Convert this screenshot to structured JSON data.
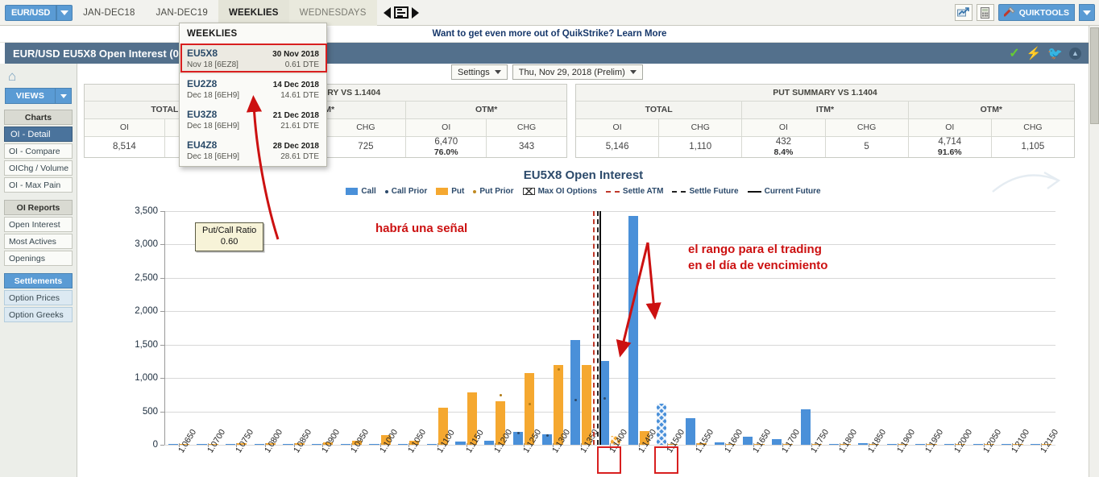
{
  "tabbar": {
    "symbol": "EUR/USD",
    "symbol_arrow": "chevron-down-icon",
    "tabs": [
      {
        "label": "JAN-DEC18",
        "state": "normal"
      },
      {
        "label": "JAN-DEC19",
        "state": "normal"
      },
      {
        "label": "WEEKLIES",
        "state": "active"
      },
      {
        "label": "WEDNESDAYS",
        "state": "dim"
      }
    ],
    "quiktools_label": "QUIKTOOLS",
    "icons": [
      "prev-arrow-icon",
      "list-view-icon",
      "next-arrow-icon",
      "chart-up-icon",
      "calculator-icon",
      "wrench-icon",
      "chevron-down-icon"
    ]
  },
  "promo": {
    "text": "Want to get even more out of QuikStrike? Learn More"
  },
  "titlebar": {
    "title": "EUR/USD EU5X8 Open Interest (0.8 ",
    "icons": [
      "check-icon",
      "bolt-icon",
      "twitter-icon",
      "collapse-icon"
    ]
  },
  "toolbar": {
    "settings_label": "Settings",
    "date_label": "Thu, Nov 29, 2018 (Prelim)"
  },
  "dropdown": {
    "header": "WEEKLIES",
    "items": [
      {
        "code": "EU5X8",
        "sub": "Nov 18  [6EZ8]",
        "date": "30 Nov 2018",
        "dte": "0.61 DTE",
        "selected": true
      },
      {
        "code": "EU2Z8",
        "sub": "Dec 18  [6EH9]",
        "date": "14 Dec 2018",
        "dte": "14.61 DTE",
        "selected": false
      },
      {
        "code": "EU3Z8",
        "sub": "Dec 18  [6EH9]",
        "date": "21 Dec 2018",
        "dte": "21.61 DTE",
        "selected": false
      },
      {
        "code": "EU4Z8",
        "sub": "Dec 18  [6EH9]",
        "date": "28 Dec 2018",
        "dte": "28.61 DTE",
        "selected": false
      }
    ]
  },
  "sidebar": {
    "home_icon": "home-icon",
    "views_label": "VIEWS",
    "groups": [
      {
        "header": "Charts",
        "style": "grey",
        "items": [
          {
            "label": "OI - Detail",
            "selected": true
          },
          {
            "label": "OI - Compare",
            "selected": false
          },
          {
            "label": "OIChg / Volume",
            "selected": false
          },
          {
            "label": "OI - Max Pain",
            "selected": false
          }
        ]
      },
      {
        "header": "OI Reports",
        "style": "grey",
        "items": [
          {
            "label": "Open Interest",
            "selected": false
          },
          {
            "label": "Most Actives",
            "selected": false
          },
          {
            "label": "Openings",
            "selected": false
          }
        ]
      },
      {
        "header": "Settlements",
        "style": "blue",
        "items": [
          {
            "label": "Option Prices",
            "selected": false,
            "light": true
          },
          {
            "label": "Option Greeks",
            "selected": false,
            "light": true
          }
        ]
      }
    ]
  },
  "call_summary": {
    "title": "CALL SUMMARY VS 1.1404",
    "groups": [
      "TOTAL",
      "ITM*",
      "OTM*"
    ],
    "subheaders": [
      "OI",
      "CHG",
      "OI",
      "CHG",
      "OI",
      "CHG"
    ],
    "values": {
      "total_oi": "8,514",
      "total_chg": "",
      "itm_oi": "",
      "itm_chg": "725",
      "otm_oi": "6,470",
      "otm_pct": "76.0%",
      "otm_chg": "343"
    }
  },
  "put_summary": {
    "title": "PUT SUMMARY VS 1.1404",
    "groups": [
      "TOTAL",
      "ITM*",
      "OTM*"
    ],
    "subheaders": [
      "OI",
      "CHG",
      "OI",
      "CHG",
      "OI",
      "CHG"
    ],
    "values": {
      "total_oi": "5,146",
      "total_chg": "1,110",
      "itm_oi": "432",
      "itm_pct": "8.4%",
      "itm_chg": "5",
      "otm_oi": "4,714",
      "otm_pct": "91.6%",
      "otm_chg": "1,105"
    }
  },
  "annotations": {
    "put_call_ratio_label": "Put/Call Ratio",
    "put_call_ratio_value": "0.60",
    "note1": "habrá una señal",
    "note2_line1": "el rango para el trading",
    "note2_line2": "en el día de vencimiento",
    "highlight_strikes": [
      "1.1400",
      "1.1500"
    ],
    "annotation_color": "#cc1111"
  },
  "chart_data": {
    "type": "bar",
    "title": "EU5X8 Open Interest",
    "xlabel": "",
    "ylabel": "",
    "ylim": [
      0,
      3500
    ],
    "yticks": [
      0,
      500,
      1000,
      1500,
      2000,
      2500,
      3000,
      3500
    ],
    "ytick_labels": [
      "0",
      "500",
      "1,000",
      "1,500",
      "2,000",
      "2,500",
      "3,000",
      "3,500"
    ],
    "grid": true,
    "legend_position": "top",
    "legend": [
      {
        "label": "Call",
        "color": "#4a90d9",
        "marker": "square"
      },
      {
        "label": "Call Prior",
        "color": "#2c4a6b",
        "marker": "dot"
      },
      {
        "label": "Put",
        "color": "#f5a830",
        "marker": "square"
      },
      {
        "label": "Put Prior",
        "color": "#c08a22",
        "marker": "dot"
      },
      {
        "label": "Max OI Options",
        "color": "#333333",
        "marker": "hatched"
      },
      {
        "label": "Settle ATM",
        "color": "#c0392b",
        "marker": "dashed"
      },
      {
        "label": "Settle Future",
        "color": "#222222",
        "marker": "dashed"
      },
      {
        "label": "Current Future",
        "color": "#111111",
        "marker": "solid"
      }
    ],
    "categories": [
      "1.0650",
      "1.0700",
      "1.0750",
      "1.0800",
      "1.0850",
      "1.0900",
      "1.0950",
      "1.1000",
      "1.1050",
      "1.1100",
      "1.1150",
      "1.1200",
      "1.1250",
      "1.1300",
      "1.1350",
      "1.1400",
      "1.1450",
      "1.1500",
      "1.1550",
      "1.1600",
      "1.1650",
      "1.1700",
      "1.1750",
      "1.1800",
      "1.1850",
      "1.1900",
      "1.1950",
      "1.2000",
      "1.2050",
      "1.2100",
      "1.2150"
    ],
    "series": [
      {
        "name": "Call",
        "color": "#4a90d9",
        "values": [
          10,
          10,
          12,
          12,
          10,
          10,
          12,
          10,
          12,
          10,
          45,
          60,
          195,
          160,
          1565,
          1250,
          3430,
          620,
          395,
          40,
          120,
          85,
          535,
          10,
          30,
          15,
          8,
          6,
          5,
          4,
          3
        ]
      },
      {
        "name": "Put",
        "color": "#f5a830",
        "values": [
          6,
          6,
          30,
          26,
          30,
          38,
          60,
          145,
          65,
          555,
          790,
          650,
          1075,
          1190,
          1190,
          130,
          205,
          15,
          30,
          10,
          12,
          10,
          12,
          8,
          6,
          5,
          4,
          3,
          3,
          2,
          2
        ]
      },
      {
        "name": "Call Prior",
        "color": "#2c4a6b",
        "values": [
          null,
          null,
          null,
          null,
          null,
          null,
          null,
          null,
          null,
          null,
          null,
          null,
          180,
          150,
          680,
          700,
          null,
          null,
          null,
          null,
          null,
          null,
          null,
          null,
          null,
          null,
          null,
          null,
          null,
          null,
          null
        ]
      },
      {
        "name": "Put Prior",
        "color": "#c08a22",
        "values": [
          null,
          null,
          null,
          null,
          null,
          null,
          null,
          null,
          null,
          null,
          null,
          750,
          620,
          1130,
          null,
          null,
          null,
          null,
          null,
          null,
          null,
          null,
          null,
          null,
          null,
          null,
          null,
          null,
          null,
          null,
          null
        ]
      }
    ],
    "max_oi_options": {
      "call_strike": "1.1500",
      "put_strike": "1.1400"
    },
    "reference_lines": [
      {
        "name": "Settle ATM",
        "x": "1.1400",
        "style": "dashed",
        "color": "#c0392b"
      },
      {
        "name": "Settle Future",
        "x": "1.1400",
        "style": "dashed",
        "color": "#222222"
      },
      {
        "name": "Current Future",
        "x": "1.1404",
        "style": "solid",
        "color": "#111111"
      }
    ],
    "put_call_ratio": 0.6
  }
}
